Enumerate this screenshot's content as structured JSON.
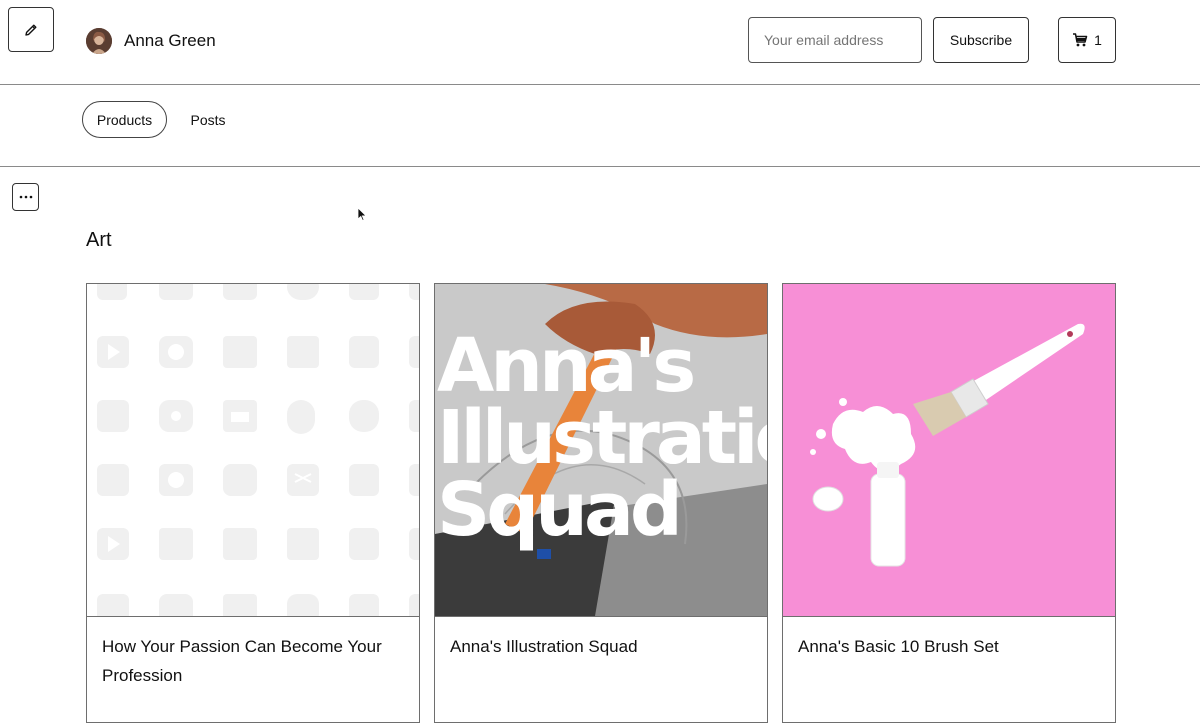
{
  "header": {
    "edit_icon": "pencil-icon",
    "user_name": "Anna Green",
    "email_placeholder": "Your email address",
    "subscribe_label": "Subscribe",
    "cart_icon": "cart-icon",
    "cart_count": "1"
  },
  "tabs": [
    {
      "label": "Products",
      "active": true
    },
    {
      "label": "Posts",
      "active": false
    }
  ],
  "section": {
    "more_icon": "ellipsis-icon",
    "title": "Art"
  },
  "products": [
    {
      "title": "How Your Passion Can Become Your Profession",
      "image": "placeholder-icon-pattern"
    },
    {
      "title": "Anna's Illustration Squad",
      "image_text": [
        "Anna's",
        "Illustratio",
        "Squad"
      ]
    },
    {
      "title": "Anna's Basic 10 Brush Set",
      "image": "paint-brush-on-pink"
    }
  ],
  "colors": {
    "pink": "#f78fd6",
    "dark_photo": "#3a3a3a",
    "border": "#333333"
  }
}
